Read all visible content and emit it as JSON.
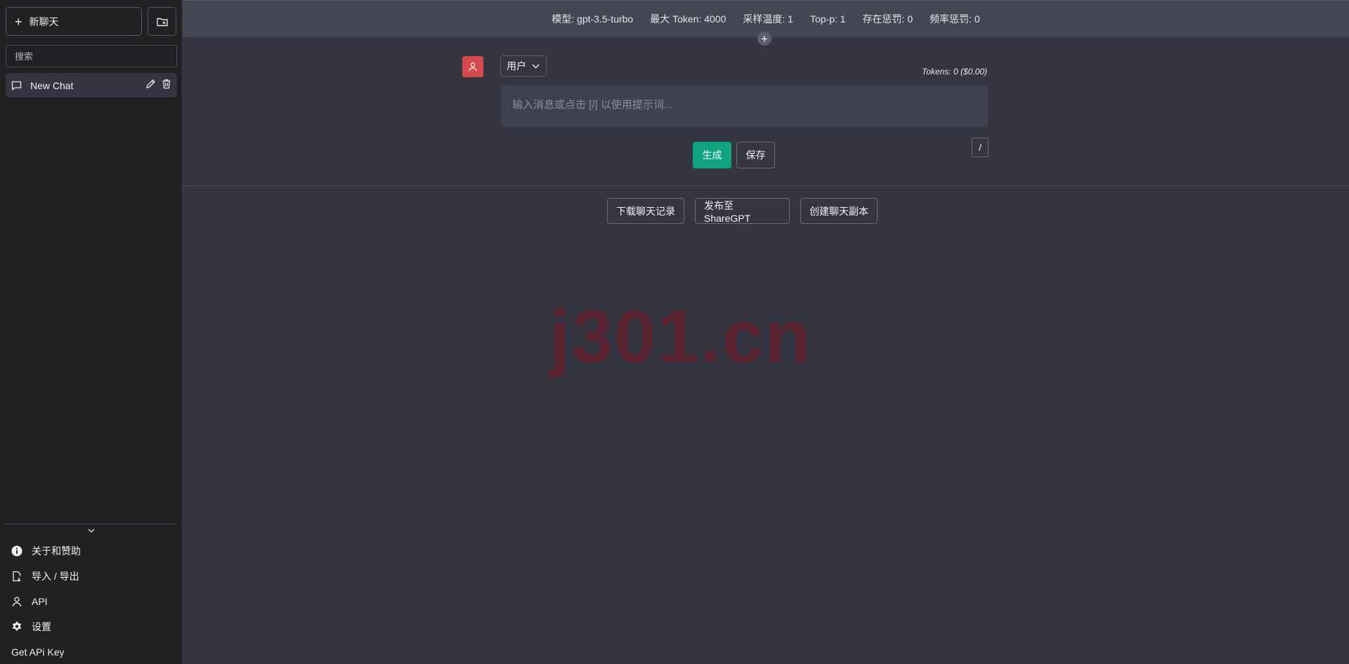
{
  "sidebar": {
    "new_chat_label": "新聊天",
    "search_placeholder": "搜索",
    "chats": [
      {
        "title": "New Chat"
      }
    ],
    "menu": [
      {
        "label": "关于和赞助",
        "icon": "info-icon"
      },
      {
        "label": "导入 / 导出",
        "icon": "import-export-icon"
      },
      {
        "label": "API",
        "icon": "person-icon"
      },
      {
        "label": "设置",
        "icon": "gear-icon"
      },
      {
        "label": "Get APi Key",
        "icon": ""
      }
    ]
  },
  "config_bar": {
    "model": "模型: gpt-3.5-turbo",
    "max_tokens": "最大 Token: 4000",
    "temperature": "采样温度: 1",
    "top_p": "Top-p: 1",
    "presence_penalty": "存在惩罚: 0",
    "frequency_penalty": "频率惩罚: 0"
  },
  "message": {
    "role": "用户",
    "tokens": "Tokens: 0 ($0.00)",
    "placeholder": "输入消息或点击 [/] 以使用提示词...",
    "value": "",
    "slash_label": "/",
    "generate_label": "生成",
    "save_label": "保存"
  },
  "actions": {
    "download": "下载聊天记录",
    "share": "发布至 ShareGPT",
    "clone": "创建聊天副本"
  },
  "watermark": "j301.cn",
  "colors": {
    "sidebar_bg": "#202123",
    "main_bg": "#353642",
    "config_bar_bg": "#444654",
    "accent_green": "#10a37f",
    "avatar_red": "#d24a4e"
  }
}
